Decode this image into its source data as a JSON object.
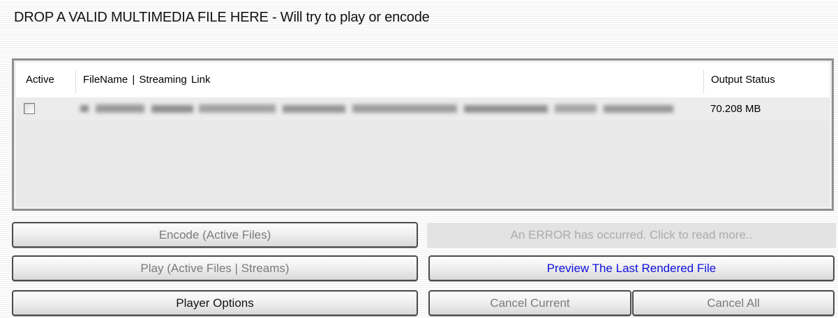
{
  "drop_zone": {
    "title": "DROP A VALID MULTIMEDIA FILE HERE - Will try to play or encode"
  },
  "file_list": {
    "columns": {
      "active": "Active",
      "filename": "FileName  |  Streaming Link",
      "status": "Output Status"
    },
    "rows": [
      {
        "active_checked": false,
        "filename": "",
        "filename_blurred": true,
        "status": "70.208 MB"
      }
    ]
  },
  "buttons": {
    "encode": "Encode (Active Files)",
    "play": "Play (Active Files | Streams)",
    "player_options": "Player Options",
    "preview": "Preview The Last Rendered File",
    "cancel_current": "Cancel Current",
    "cancel_all": "Cancel All"
  },
  "error_message": "An ERROR has occurred. Click to read more..",
  "colors": {
    "preview_text": "#1010e0",
    "disabled_text": "#7b7b7b",
    "error_text": "#ababab"
  }
}
